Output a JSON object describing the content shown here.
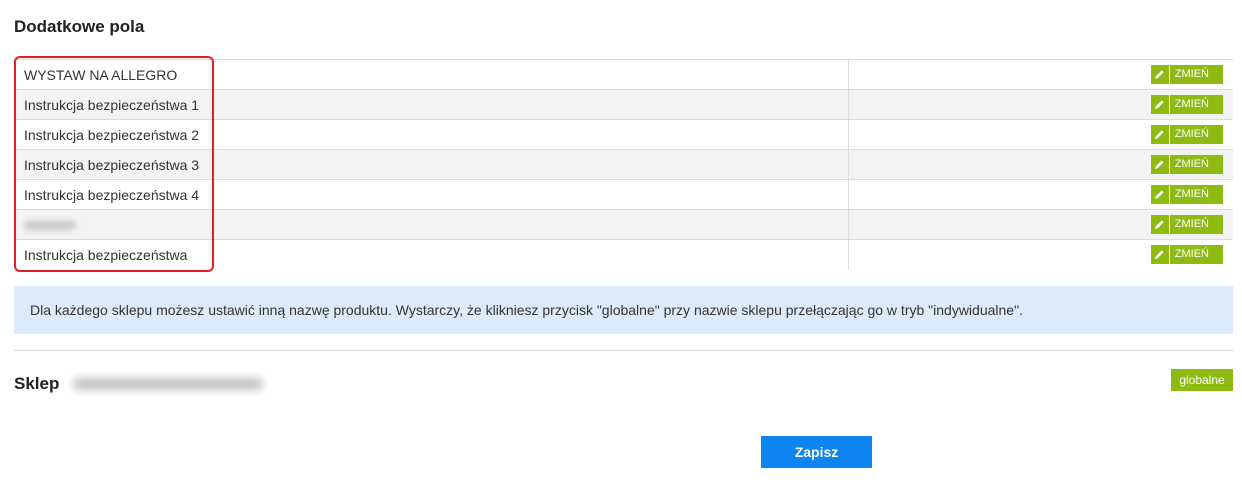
{
  "section_title": "Dodatkowe pola",
  "edit_label": "ZMIEŃ",
  "fields": [
    {
      "name": "WYSTAW NA ALLEGRO",
      "blurred": false
    },
    {
      "name": "Instrukcja bezpieczeństwa 1",
      "blurred": false
    },
    {
      "name": "Instrukcja bezpieczeństwa 2",
      "blurred": false
    },
    {
      "name": "Instrukcja bezpieczeństwa 3",
      "blurred": false
    },
    {
      "name": "Instrukcja bezpieczeństwa 4",
      "blurred": false
    },
    {
      "name": "",
      "blurred": true
    },
    {
      "name": "Instrukcja bezpieczeństwa",
      "blurred": false
    }
  ],
  "info_text": "Dla każdego sklepu możesz ustawić inną nazwę produktu. Wystarczy, że klikniesz przycisk \"globalne\" przy nazwie sklepu przełączając go w tryb \"indywidualne\".",
  "shop": {
    "label": "Sklep",
    "global_label": "globalne"
  },
  "save_label": "Zapisz",
  "colors": {
    "accent_green": "#8dbb11",
    "save_blue": "#0d85f0",
    "info_bg": "#dcebfb",
    "highlight_red": "#e31e24"
  }
}
